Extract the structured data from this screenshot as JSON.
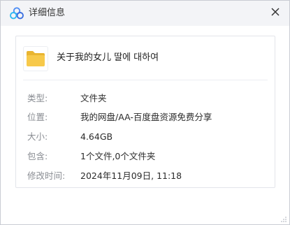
{
  "window": {
    "title": "详细信息",
    "logo_icon": "baidu-netdisk-logo",
    "close_icon": "close-icon"
  },
  "file": {
    "icon": "folder-icon",
    "name": "关于我的女儿 딸에 대하여"
  },
  "details": [
    {
      "label": "类型:",
      "value": "文件夹"
    },
    {
      "label": "位置:",
      "value": "我的网盘/AA-百度盘资源免费分享"
    },
    {
      "label": "大小:",
      "value": "4.64GB"
    },
    {
      "label": "包含:",
      "value": "1个文件,0个文件夹"
    },
    {
      "label": "修改时间:",
      "value": "2024年11月09日, 11:18"
    }
  ],
  "colors": {
    "titlebar_bg": "#f3f4f7",
    "folder_yellow": "#f7c94a",
    "logo_blue": "#4e8df5",
    "label_gray": "#8a8d93"
  }
}
